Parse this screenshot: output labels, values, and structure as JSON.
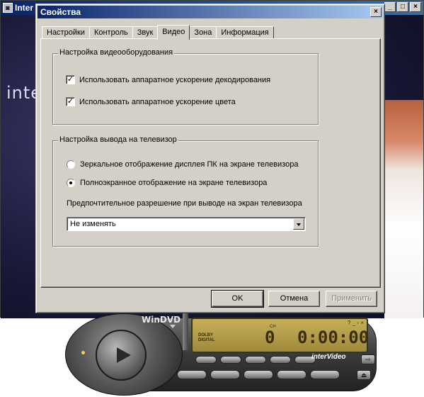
{
  "background_window": {
    "title": "Inter",
    "icon": "windvd-app-icon",
    "brand_text": "inte",
    "buttons": {
      "minimize": "_",
      "maximize": "□",
      "close": "×"
    }
  },
  "dialog": {
    "title": "Свойства",
    "close_label": "×",
    "tabs": [
      {
        "label": "Настройки",
        "active": false
      },
      {
        "label": "Контроль",
        "active": false
      },
      {
        "label": "Звук",
        "active": false
      },
      {
        "label": "Видео",
        "active": true
      },
      {
        "label": "Зона",
        "active": false
      },
      {
        "label": "Информация",
        "active": false
      }
    ],
    "video_hardware_group": {
      "title": "Настройка видеооборудования",
      "options": [
        {
          "label": "Использовать аппаратное ускорение декодирования",
          "checked": true
        },
        {
          "label": "Использовать аппаратное ускорение цвета",
          "checked": true
        }
      ]
    },
    "tv_output_group": {
      "title": "Настройка вывода на телевизор",
      "options": [
        {
          "label": "Зеркальное отображение дисплея ПК на экране телевизора",
          "selected": false
        },
        {
          "label": "Полноэкранное отображение на экране телевизора",
          "selected": true
        }
      ],
      "resolution_label": "Предпочтительное разрешение при выводе на экран телевизора",
      "resolution_value": "Не изменять"
    },
    "buttons": {
      "ok": "OK",
      "cancel": "Отмена",
      "apply": "Применить"
    }
  },
  "player": {
    "logo": "WinDVD",
    "dolby_label": "DOLBY",
    "digital_label": "DIGITAL",
    "ch_label": "CH",
    "chapter": "0",
    "time": "0:00:00",
    "brand": "interVideo",
    "lcd_icons": "? _ ▫ ×",
    "side_buttons": {
      "forward": "⇨",
      "eject": "⏏"
    }
  },
  "colors": {
    "dialog_face": "#d4d0c8",
    "titlebar_start": "#0a246a",
    "titlebar_end": "#a6caf0",
    "lcd_gold": "#c6b15a"
  }
}
